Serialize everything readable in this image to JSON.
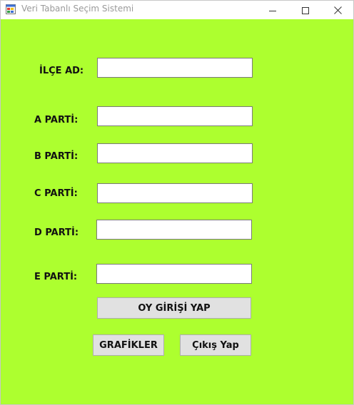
{
  "window": {
    "title": "Veri Tabanlı Seçim Sistemi",
    "icon": "windows-form-icon",
    "controls": {
      "minimize_icon": "minimize-icon",
      "maximize_icon": "maximize-icon",
      "close_icon": "close-icon"
    }
  },
  "form": {
    "background_color": "#adff2f",
    "fields": {
      "ilce_ad": {
        "label": "İLÇE AD:",
        "value": ""
      },
      "a_parti": {
        "label": "A PARTİ:",
        "value": ""
      },
      "b_parti": {
        "label": "B PARTİ:",
        "value": ""
      },
      "c_parti": {
        "label": "C PARTİ:",
        "value": ""
      },
      "d_parti": {
        "label": "D PARTİ:",
        "value": ""
      },
      "e_parti": {
        "label": "E PARTİ:",
        "value": ""
      }
    },
    "buttons": {
      "oy_girisi": "OY GİRİŞİ YAP",
      "grafikler": "GRAFİKLER",
      "cikis": "Çıkış Yap"
    }
  }
}
